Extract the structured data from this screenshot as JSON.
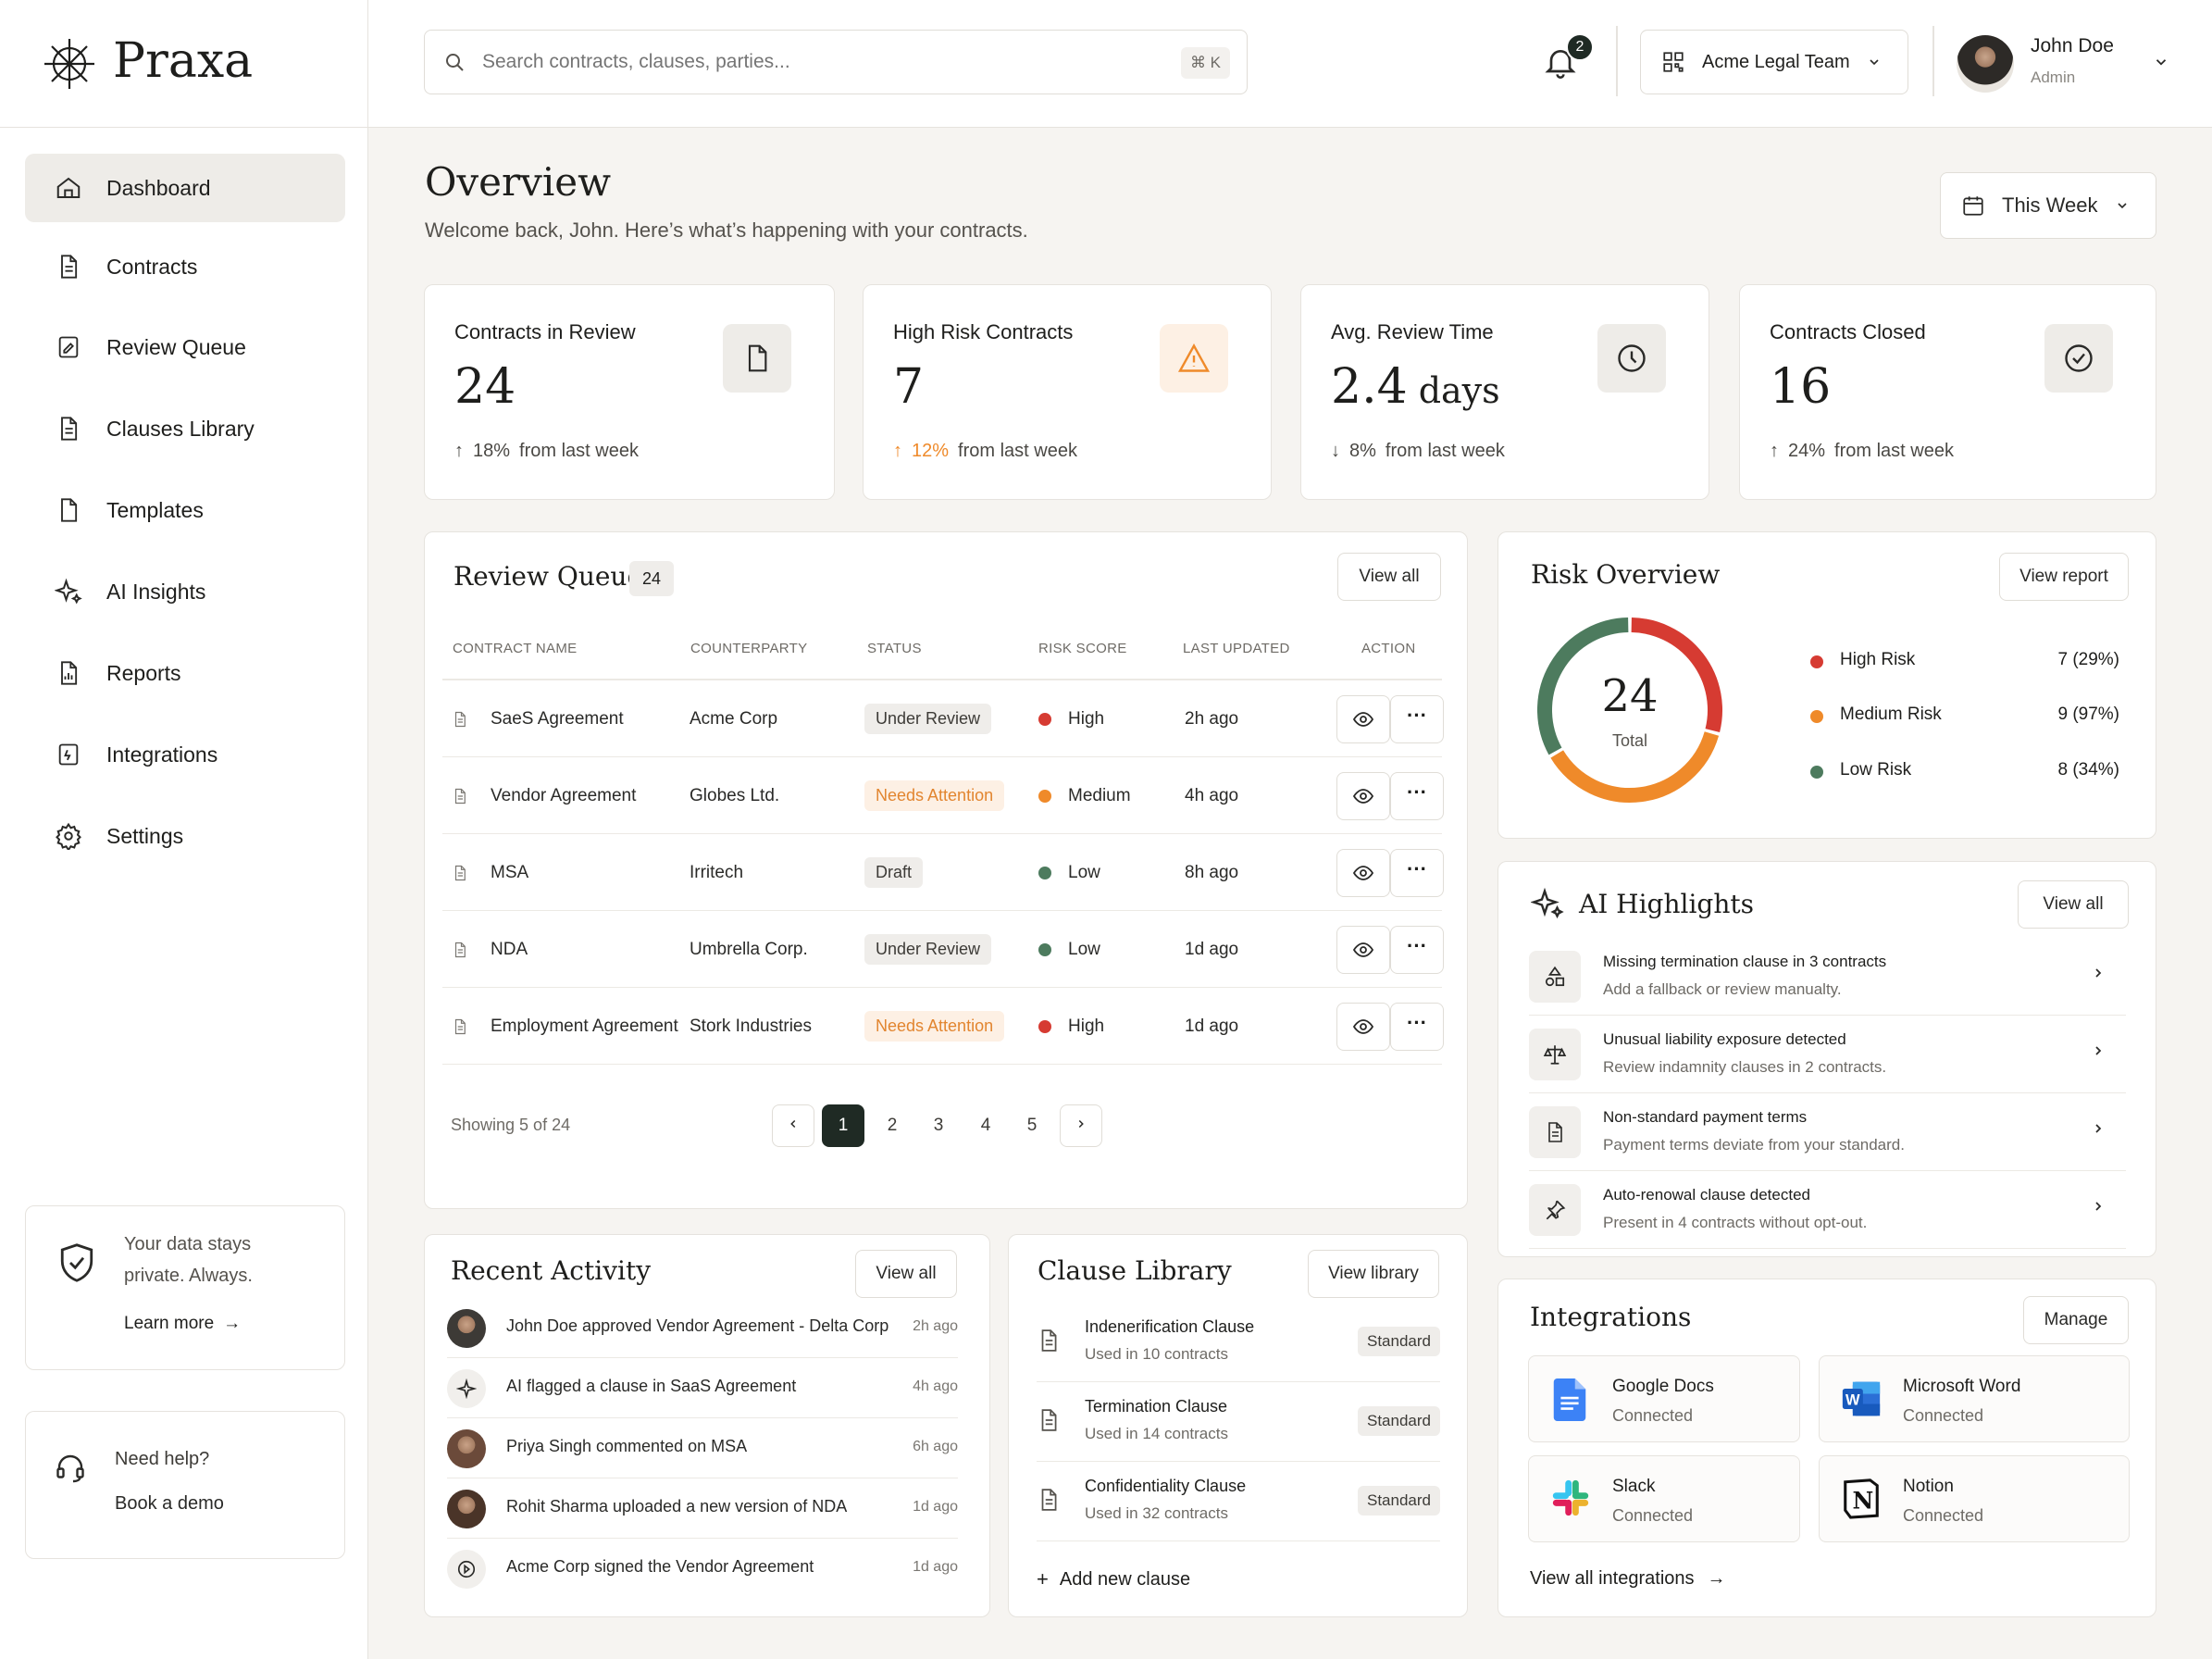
{
  "brand": {
    "name": "Praxa"
  },
  "nav": [
    {
      "label": "Dashboard",
      "icon": "home-icon"
    },
    {
      "label": "Contracts",
      "icon": "document-icon"
    },
    {
      "label": "Review Queue",
      "icon": "review-icon"
    },
    {
      "label": "Clauses Library",
      "icon": "document-icon"
    },
    {
      "label": "Templates",
      "icon": "file-icon"
    },
    {
      "label": "AI Insights",
      "icon": "sparkle-icon"
    },
    {
      "label": "Reports",
      "icon": "chart-file-icon"
    },
    {
      "label": "Integrations",
      "icon": "plug-icon"
    },
    {
      "label": "Settings",
      "icon": "gear-icon"
    }
  ],
  "privacy": {
    "line1": "Your data stays",
    "line2": "private. Always.",
    "link": "Learn more"
  },
  "help": {
    "title": "Need help?",
    "link": "Book a demo"
  },
  "search": {
    "placeholder": "Search contracts, clauses, parties...",
    "shortcut": "⌘ K"
  },
  "notifications": {
    "count": "2"
  },
  "team": {
    "name": "Acme Legal Team"
  },
  "user": {
    "name": "John Doe",
    "role": "Admin"
  },
  "page": {
    "title": "Overview",
    "subtitle": "Welcome back, John. Here’s what’s happening with your contracts.",
    "period": "This Week"
  },
  "stats": [
    {
      "title": "Contracts in Review",
      "value": "24",
      "unit": "",
      "trend": "18%",
      "trend_suffix": "from last week",
      "direction": "up",
      "icon": "document-icon"
    },
    {
      "title": "High Risk Contracts",
      "value": "7",
      "unit": "",
      "trend": "12%",
      "trend_suffix": "from last week",
      "direction": "up",
      "icon": "warning-icon"
    },
    {
      "title": "Avg. Review Time",
      "value": "2.4",
      "unit": "days",
      "trend": "8%",
      "trend_suffix": "from last week",
      "direction": "down",
      "icon": "clock-icon"
    },
    {
      "title": "Contracts Closed",
      "value": "16",
      "unit": "",
      "trend": "24%",
      "trend_suffix": "from last week",
      "direction": "up",
      "icon": "check-circle-icon"
    }
  ],
  "review_queue": {
    "title": "Review Queue",
    "count": "24",
    "view_all": "View all",
    "columns": [
      "CONTRACT NAME",
      "COUNTERPARTY",
      "STATUS",
      "RISK SCORE",
      "LAST UPDATED",
      "ACTION"
    ],
    "rows": [
      {
        "name": "SaeS Agreement",
        "counterparty": "Acme Corp",
        "status": "Under Review",
        "status_style": "grey",
        "risk": "High",
        "risk_color": "#d63b32",
        "updated": "2h ago"
      },
      {
        "name": "Vendor Agreement",
        "counterparty": "Globes Ltd.",
        "status": "Needs Attention",
        "status_style": "orange",
        "risk": "Medium",
        "risk_color": "#ef8a2a",
        "updated": "4h ago"
      },
      {
        "name": "MSA",
        "counterparty": "Irritech",
        "status": "Draft",
        "status_style": "grey",
        "risk": "Low",
        "risk_color": "#4d7b5e",
        "updated": "8h ago"
      },
      {
        "name": "NDA",
        "counterparty": "Umbrella Corp.",
        "status": "Under Review",
        "status_style": "grey",
        "risk": "Low",
        "risk_color": "#4d7b5e",
        "updated": "1d ago"
      },
      {
        "name": "Employment Agreement",
        "counterparty": "Stork Industries",
        "status": "Needs Attention",
        "status_style": "orange",
        "risk": "High",
        "risk_color": "#d63b32",
        "updated": "1d ago"
      }
    ],
    "showing": "Showing 5 of 24",
    "pages": [
      "1",
      "2",
      "3",
      "4",
      "5"
    ],
    "current_page": "1"
  },
  "risk": {
    "title": "Risk Overview",
    "view_report": "View report",
    "total": "24",
    "total_label": "Total",
    "items": [
      {
        "label": "High Risk",
        "value": "7 (29%)",
        "color": "#d63b32"
      },
      {
        "label": "Medium Risk",
        "value": "9 (97%)",
        "color": "#ef8a2a"
      },
      {
        "label": "Low Risk",
        "value": "8 (34%)",
        "color": "#4d7b5e"
      }
    ]
  },
  "chart_data": {
    "type": "pie",
    "title": "Risk Overview",
    "categories": [
      "High Risk",
      "Medium Risk",
      "Low Risk"
    ],
    "values": [
      7,
      9,
      8
    ],
    "center_label": "24",
    "center_sublabel": "Total",
    "colors": [
      "#d63b32",
      "#ef8a2a",
      "#4d7b5e"
    ],
    "legend": "right"
  },
  "highlights": {
    "title": "AI Highlights",
    "view_all": "View all",
    "items": [
      {
        "title": "Missing termination clause in 3 contracts",
        "desc": "Add a fallback or review manualty.",
        "icon": "shapes-icon"
      },
      {
        "title": "Unusual liability exposure detected",
        "desc": "Review indamnity clauses in 2 contracts.",
        "icon": "scale-icon"
      },
      {
        "title": "Non-standard payment terms",
        "desc": "Payment terms deviate from your standard.",
        "icon": "document-icon"
      },
      {
        "title": "Auto-renowal clause detected",
        "desc": "Present in 4 contracts without opt-out.",
        "icon": "pin-icon"
      }
    ]
  },
  "activity": {
    "title": "Recent Activity",
    "view_all": "View all",
    "items": [
      {
        "text": "John Doe approved Vendor Agreement - Delta Corp",
        "time": "2h ago",
        "avatar": "#3d3a36"
      },
      {
        "text": "AI flagged a clause in SaaS Agreement",
        "time": "4h ago",
        "avatar": "icon"
      },
      {
        "text": "Priya Singh commented on MSA",
        "time": "6h ago",
        "avatar": "#6b4a3a"
      },
      {
        "text": "Rohit Sharma uploaded a new version of NDA",
        "time": "1d ago",
        "avatar": "#4a3428"
      },
      {
        "text": "Acme Corp signed the Vendor Agreement",
        "time": "1d ago",
        "avatar": "icon"
      }
    ]
  },
  "clauses": {
    "title": "Clause Library",
    "view_library": "View library",
    "items": [
      {
        "name": "Indenerification Clause",
        "usage": "Used in 10 contracts",
        "tag": "Standard"
      },
      {
        "name": "Termination Clause",
        "usage": "Used in 14 contracts",
        "tag": "Standard"
      },
      {
        "name": "Confidentiality Clause",
        "usage": "Used in 32 contracts",
        "tag": "Standard"
      }
    ],
    "add": "Add new clause"
  },
  "integrations": {
    "title": "Integrations",
    "manage": "Manage",
    "items": [
      {
        "name": "Google Docs",
        "status": "Connected",
        "icon": "google-docs-icon"
      },
      {
        "name": "Microsoft Word",
        "status": "Connected",
        "icon": "word-icon"
      },
      {
        "name": "Slack",
        "status": "Connected",
        "icon": "slack-icon"
      },
      {
        "name": "Notion",
        "status": "Connected",
        "icon": "notion-icon"
      }
    ],
    "view_all": "View all integrations"
  }
}
